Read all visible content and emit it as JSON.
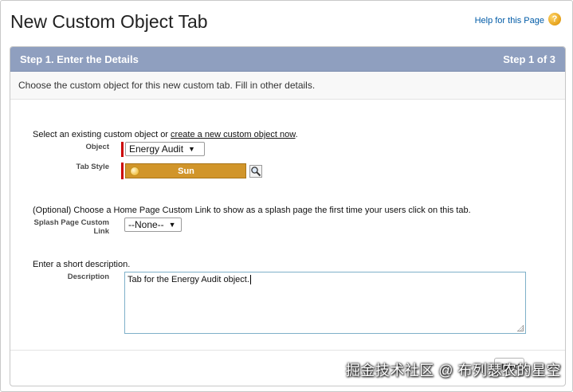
{
  "page": {
    "title": "New Custom Object Tab"
  },
  "help": {
    "label": "Help for this Page",
    "icon": "question-icon"
  },
  "step": {
    "title": "Step 1. Enter the Details",
    "counter": "Step 1 of 3"
  },
  "intro": "Choose the custom object for this new custom tab. Fill in other details.",
  "object_section": {
    "prompt": "Select an existing custom object or ",
    "link": "create a new custom object now",
    "prompt_end": ".",
    "object_label": "Object",
    "object_value": "Energy Audit",
    "tab_style_label": "Tab Style",
    "tab_style_value": "Sun",
    "tab_style_color": "#d1952a"
  },
  "splash_section": {
    "prompt": "(Optional) Choose a Home Page Custom Link to show as a splash page the first time your users click on this tab.",
    "label_line1": "Splash Page Custom",
    "label_line2": "Link",
    "value": "--None--"
  },
  "description_section": {
    "prompt": "Enter a short description.",
    "label": "Description",
    "value": "Tab for the Energy Audit object."
  },
  "footer": {
    "next_label": "Next"
  },
  "watermark": "掘金技术社区 @ 布列瑟农的星空",
  "colors": {
    "header_bg": "#8f9fbf",
    "required": "#cc0000",
    "link": "#015ba7"
  }
}
